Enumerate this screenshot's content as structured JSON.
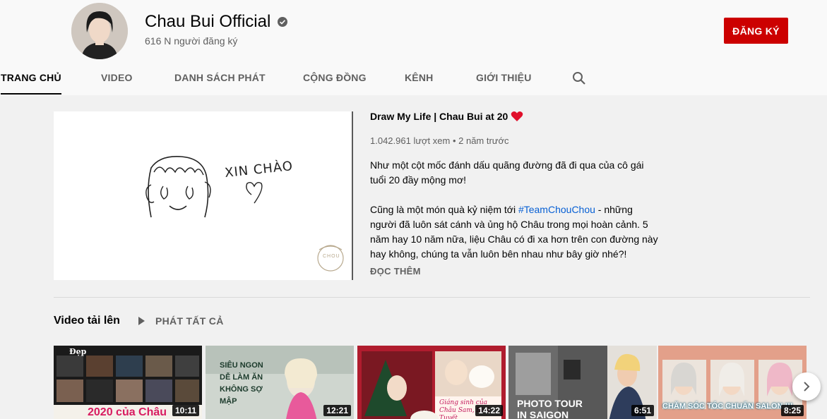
{
  "channel": {
    "name": "Chau Bui Official",
    "subscribers": "616 N người đăng ký",
    "subscribe_label": "ĐĂNG KÝ"
  },
  "tabs": [
    {
      "label": "TRANG CHỦ",
      "active": true
    },
    {
      "label": "VIDEO"
    },
    {
      "label": "DANH SÁCH PHÁT"
    },
    {
      "label": "CỘNG ĐỒNG"
    },
    {
      "label": "KÊNH"
    },
    {
      "label": "GIỚI THIỆU"
    }
  ],
  "featured": {
    "title": "Draw My Life | Chau Bui at 20",
    "meta": "1.042.961 lượt xem • 2 năm trước",
    "desc_p1": "Như một cột mốc đánh dấu quãng đường đã đi qua của cô gái tuổi 20 đầy mộng mơ!",
    "desc_p2_before": "Cũng là một món quà kỷ niệm tới ",
    "desc_hashtag": "#TeamChouChou",
    "desc_p2_after": " - những người đã luôn sát cánh và ủng hộ Châu trong mọi hoàn cảnh. 5 năm hay 10 năm nữa, liệu Châu có đi xa hơn trên con đường này hay không, chúng ta vẫn luôn bên nhau như bây giờ nhé?!",
    "read_more": "ĐỌC THÊM",
    "thumb_text": "XIN CHÀO",
    "thumb_logo": "CHOU"
  },
  "uploads": {
    "title": "Video tải lên",
    "play_all": "PHÁT TẤT CẢ",
    "videos": [
      {
        "overlay": "2020 của Châu",
        "tag": "Đẹp",
        "duration": "10:11"
      },
      {
        "overlay": "SIÊU NGON DỄ LÀM ĂN KHÔNG SỢ MẬP",
        "duration": "12:21"
      },
      {
        "overlay": "Giáng sinh của Châu Sam, Bi & Tuyết",
        "duration": "14:22"
      },
      {
        "overlay": "PHOTO TOUR IN SAIGON",
        "duration": "6:51"
      },
      {
        "overlay": "CHĂM SÓC TÓC CHUẨN SALON !!!",
        "duration": "8:25"
      }
    ]
  },
  "colors": {
    "accent_red": "#cc0000",
    "link_blue": "#065fd4",
    "heart": "#e0102b"
  },
  "icons": {
    "verified": "verified-check-icon",
    "search": "search-icon",
    "play": "play-icon",
    "next": "chevron-right-icon"
  }
}
